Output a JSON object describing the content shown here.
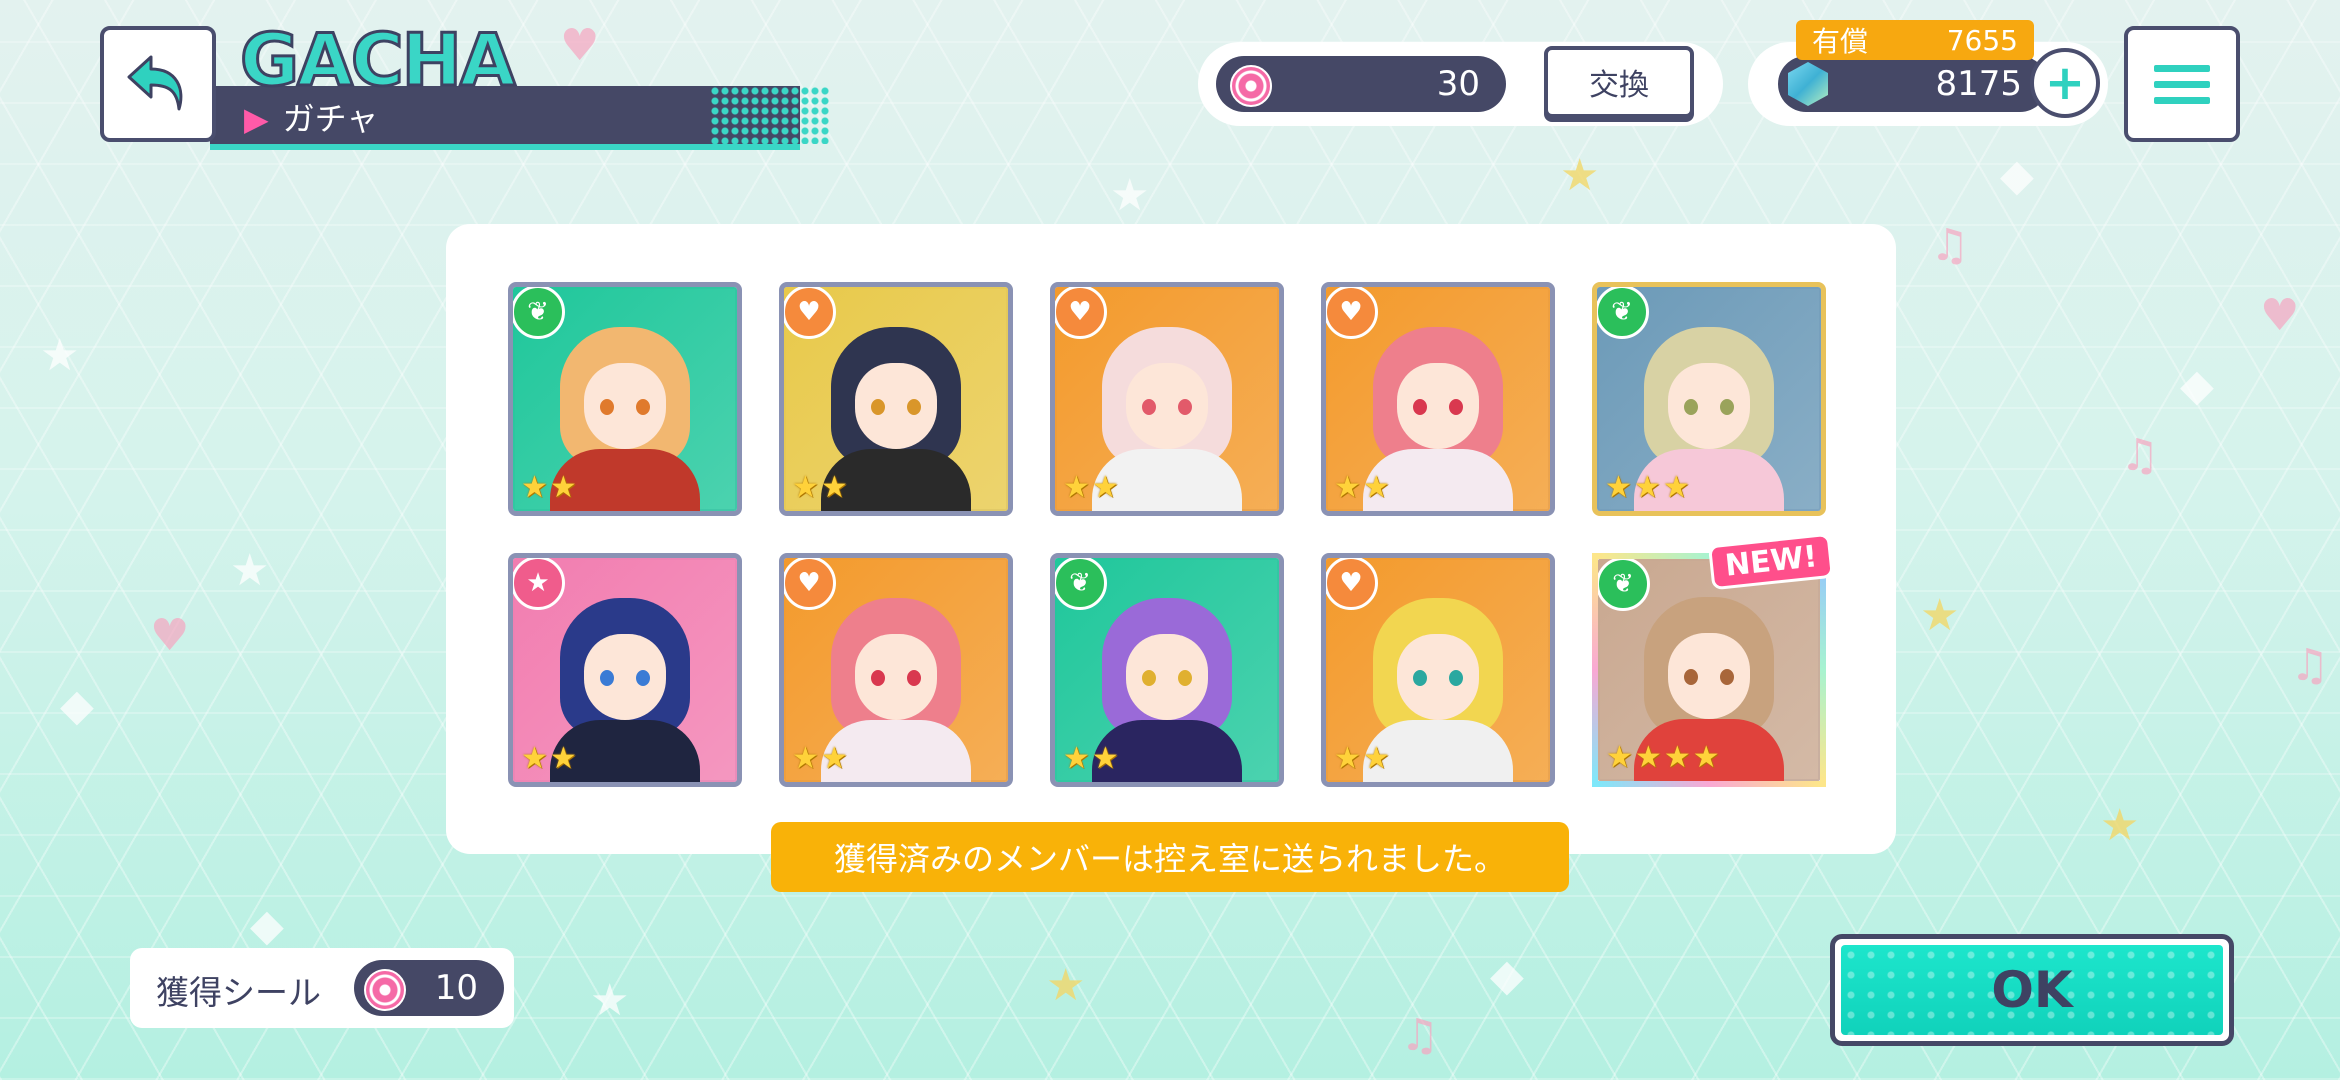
{
  "header": {
    "title_en": "GACHA",
    "title_jp": "ガチャ",
    "title_marker": "▶"
  },
  "currency": {
    "seal_count": "30",
    "exchange_label": "交換",
    "paid_label": "有償",
    "paid_value": "7655",
    "gem_count": "8175",
    "plus_label": "+"
  },
  "results": {
    "cards": [
      {
        "attribute": "sprout",
        "attr_glyph": "❦",
        "attr_color": "#2bbf5b",
        "rarity": 2,
        "bg": "#1fc79b",
        "hair": "#f2b770",
        "body": "#c0392b",
        "eye": "#e07a2c",
        "frame": "normal"
      },
      {
        "attribute": "heart",
        "attr_glyph": "♥",
        "attr_color": "#f58a3c",
        "rarity": 2,
        "bg": "#e8c94a",
        "hair": "#2f3550",
        "body": "#2a2a2a",
        "eye": "#d9962a",
        "frame": "normal"
      },
      {
        "attribute": "heart",
        "attr_glyph": "♥",
        "attr_color": "#f58a3c",
        "rarity": 2,
        "bg": "#f39a2c",
        "hair": "#f5dcdc",
        "body": "#f2f2f2",
        "eye": "#e25a6a",
        "frame": "normal"
      },
      {
        "attribute": "heart",
        "attr_glyph": "♥",
        "attr_color": "#f58a3c",
        "rarity": 2,
        "bg": "#f39a2c",
        "hair": "#ee7f8c",
        "body": "#f4eaf0",
        "eye": "#d9384f",
        "frame": "normal"
      },
      {
        "attribute": "sprout",
        "attr_glyph": "❦",
        "attr_color": "#2bbf5b",
        "rarity": 3,
        "bg": "#6c9ab8",
        "hair": "#d8d2a4",
        "body": "#f6c8d8",
        "eye": "#9aa35b",
        "frame": "gold"
      },
      {
        "attribute": "star",
        "attr_glyph": "★",
        "attr_color": "#f05c8c",
        "rarity": 2,
        "bg": "#f27db0",
        "hair": "#2a3a8a",
        "body": "#1f2540",
        "eye": "#3a7bd5",
        "frame": "normal"
      },
      {
        "attribute": "heart",
        "attr_glyph": "♥",
        "attr_color": "#f58a3c",
        "rarity": 2,
        "bg": "#f39a2c",
        "hair": "#ee7f8c",
        "body": "#f4eaf0",
        "eye": "#d9384f",
        "frame": "normal"
      },
      {
        "attribute": "sprout",
        "attr_glyph": "❦",
        "attr_color": "#2bbf5b",
        "rarity": 2,
        "bg": "#1fc79b",
        "hair": "#9a6ad8",
        "body": "#2a2560",
        "eye": "#e0b030",
        "frame": "normal"
      },
      {
        "attribute": "heart",
        "attr_glyph": "♥",
        "attr_color": "#f58a3c",
        "rarity": 2,
        "bg": "#f39a2c",
        "hair": "#f2d650",
        "body": "#f0f0f0",
        "eye": "#2ba8a0",
        "frame": "normal"
      },
      {
        "attribute": "sprout",
        "attr_glyph": "❦",
        "attr_color": "#2bbf5b",
        "rarity": 4,
        "bg": "#c9a890",
        "hair": "#c8a27e",
        "body": "#e0423c",
        "eye": "#a8663a",
        "frame": "rainbow",
        "new_label": "NEW!"
      }
    ],
    "star_glyph": "★",
    "notice": "獲得済みのメンバーは控え室に送られました。"
  },
  "footer": {
    "seal_label": "獲得シール",
    "seal_earned": "10",
    "ok_label": "OK"
  }
}
